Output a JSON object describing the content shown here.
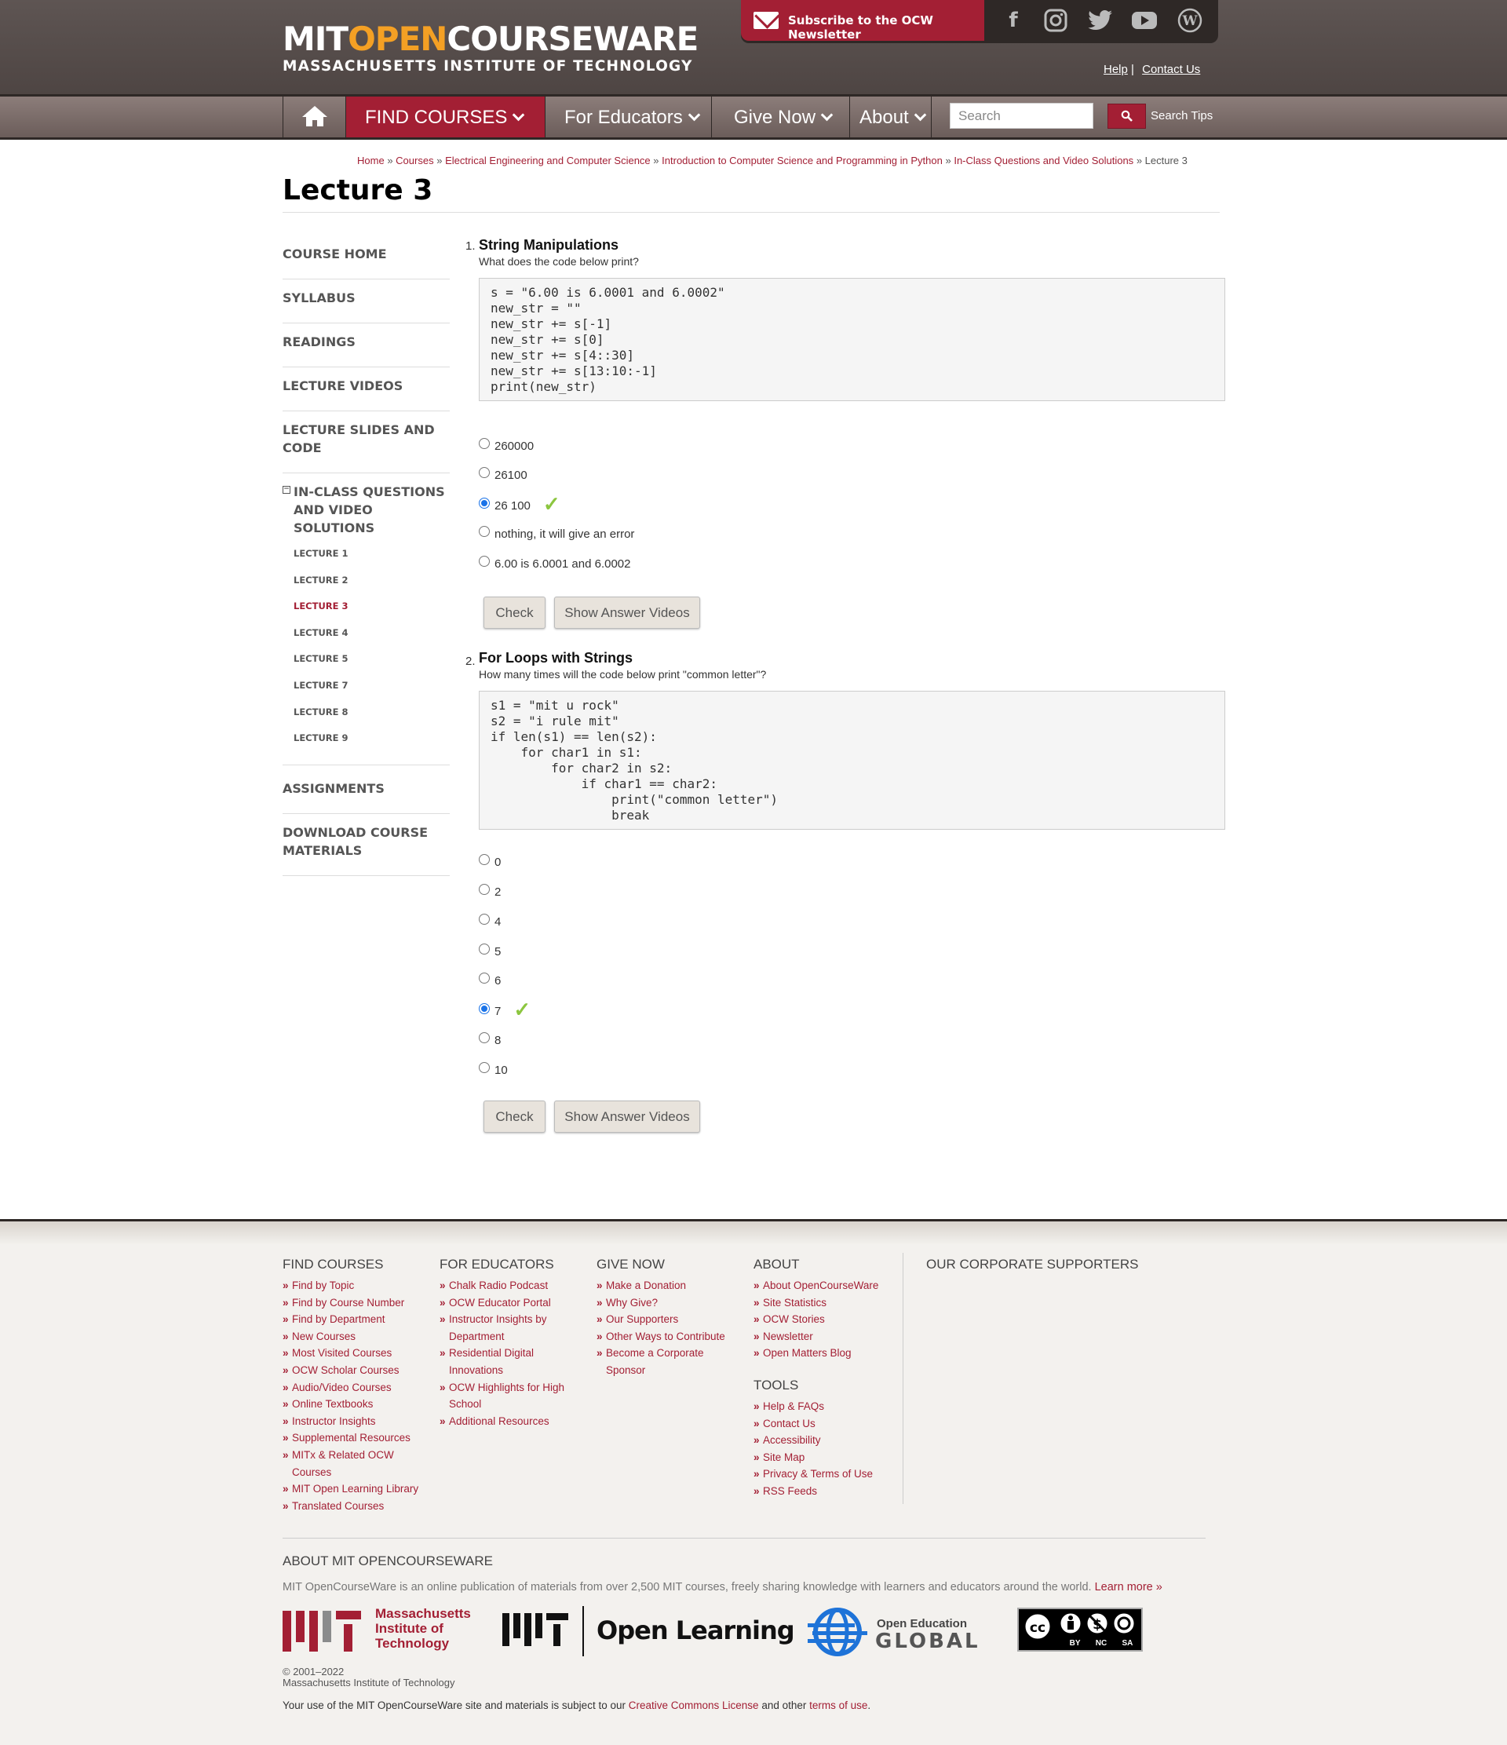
{
  "header": {
    "logo_part1": "MIT",
    "logo_part2": "OPEN",
    "logo_part3": "COURSEWARE",
    "logo_subtitle": "MASSACHUSETTS INSTITUTE OF TECHNOLOGY",
    "subscribe_label": "Subscribe to the OCW Newsletter",
    "help_label": "Help",
    "contact_label": "Contact Us",
    "social_icons": [
      "facebook-icon",
      "instagram-icon",
      "twitter-icon",
      "youtube-icon",
      "wordpress-icon"
    ]
  },
  "nav": {
    "home_icon": "home-icon",
    "items": [
      {
        "label": "FIND COURSES"
      },
      {
        "label": "For Educators"
      },
      {
        "label": "Give Now"
      },
      {
        "label": "About"
      }
    ],
    "search_placeholder": "Search",
    "search_tips": "Search Tips"
  },
  "breadcrumb": {
    "items": [
      "Home",
      "Courses",
      "Electrical Engineering and Computer Science",
      "Introduction to Computer Science and Programming in Python",
      "In-Class Questions and Video Solutions"
    ],
    "current": "Lecture 3",
    "separator": "»"
  },
  "page_title": "Lecture 3",
  "sidebar": {
    "items": [
      {
        "label": "COURSE HOME"
      },
      {
        "label": "SYLLABUS"
      },
      {
        "label": "READINGS"
      },
      {
        "label": "LECTURE VIDEOS"
      },
      {
        "label": "LECTURE SLIDES AND CODE"
      }
    ],
    "inclass_label": "IN-CLASS QUESTIONS AND VIDEO SOLUTIONS",
    "collapse_symbol": "−",
    "subitems": [
      "LECTURE 1",
      "LECTURE 2",
      "LECTURE 3",
      "LECTURE 4",
      "LECTURE 5",
      "LECTURE 7",
      "LECTURE 8",
      "LECTURE 9"
    ],
    "active_subitem": "LECTURE 3",
    "after_items": [
      {
        "label": "ASSIGNMENTS"
      },
      {
        "label": "DOWNLOAD COURSE MATERIALS"
      }
    ]
  },
  "questions": [
    {
      "number": "1.",
      "title": "String Manipulations",
      "prompt": "What does the code below print?",
      "code": "s = \"6.00 is 6.0001 and 6.0002\"\nnew_str = \"\"\nnew_str += s[-1]\nnew_str += s[0]\nnew_str += s[4::30]\nnew_str += s[13:10:-1]\nprint(new_str)",
      "options": [
        "260000",
        "26100",
        "26 100",
        "nothing, it will give an error",
        "6.00 is 6.0001 and 6.0002"
      ],
      "selected_index": 2,
      "check_label": "Check",
      "videos_label": "Show Answer Videos"
    },
    {
      "number": "2.",
      "title": "For Loops with Strings",
      "prompt": "How many times will the code below print \"common letter\"?",
      "code": "s1 = \"mit u rock\"\ns2 = \"i rule mit\"\nif len(s1) == len(s2):\n    for char1 in s1:\n        for char2 in s2:\n            if char1 == char2:\n                print(\"common letter\")\n                break",
      "options": [
        "0",
        "2",
        "4",
        "5",
        "6",
        "7",
        "8",
        "10"
      ],
      "selected_index": 5,
      "check_label": "Check",
      "videos_label": "Show Answer Videos"
    }
  ],
  "footer": {
    "columns": [
      {
        "heading": "FIND COURSES",
        "links": [
          "Find by Topic",
          "Find by Course Number",
          "Find by Department",
          "New Courses",
          "Most Visited Courses",
          "OCW Scholar Courses",
          "Audio/Video Courses",
          "Online Textbooks",
          "Instructor Insights",
          "Supplemental Resources",
          "MITx & Related OCW Courses",
          "MIT Open Learning Library",
          "Translated Courses"
        ]
      },
      {
        "heading": "FOR EDUCATORS",
        "links": [
          "Chalk Radio Podcast",
          "OCW Educator Portal",
          "Instructor Insights by Department",
          "Residential Digital Innovations",
          "OCW Highlights for High School",
          "Additional Resources"
        ]
      },
      {
        "heading": "GIVE NOW",
        "links": [
          "Make a Donation",
          "Why Give?",
          "Our Supporters",
          "Other Ways to Contribute",
          "Become a Corporate Sponsor"
        ]
      },
      {
        "heading": "ABOUT",
        "links": [
          "About OpenCourseWare",
          "Site Statistics",
          "OCW Stories",
          "Newsletter",
          "Open Matters Blog"
        ]
      }
    ],
    "tools_heading": "TOOLS",
    "tools_links": [
      "Help & FAQs",
      "Contact Us",
      "Accessibility",
      "Site Map",
      "Privacy & Terms of Use",
      "RSS Feeds"
    ],
    "supporters_heading": "OUR CORPORATE SUPPORTERS",
    "about_heading": "ABOUT MIT OPENCOURSEWARE",
    "about_text": "MIT OpenCourseWare is an online publication of materials from over 2,500 MIT courses, freely sharing knowledge with learners and educators around the world.",
    "learn_more": "Learn more »",
    "logo_mit_text1": "Massachusetts",
    "logo_mit_text2": "Institute of",
    "logo_mit_text3": "Technology",
    "logo_openlearning_text": "Open Learning",
    "logo_oeg_text1": "Open Education",
    "logo_oeg_text2": "GLOBAL",
    "logo_cc_labels": [
      "BY",
      "NC",
      "SA"
    ],
    "copyright_years": "© 2001–2022",
    "copyright_org": "Massachusetts Institute of Technology",
    "license_prefix": "Your use of the MIT OpenCourseWare site and materials is subject to our",
    "license_link": "Creative Commons License",
    "license_middle": "and other",
    "terms_link": "terms of use",
    "license_suffix": "."
  },
  "colors": {
    "brand": "#a31f34",
    "header_bg": "#554c4a",
    "accent_orange": "#f4a024",
    "check_green": "#8cc63f"
  }
}
